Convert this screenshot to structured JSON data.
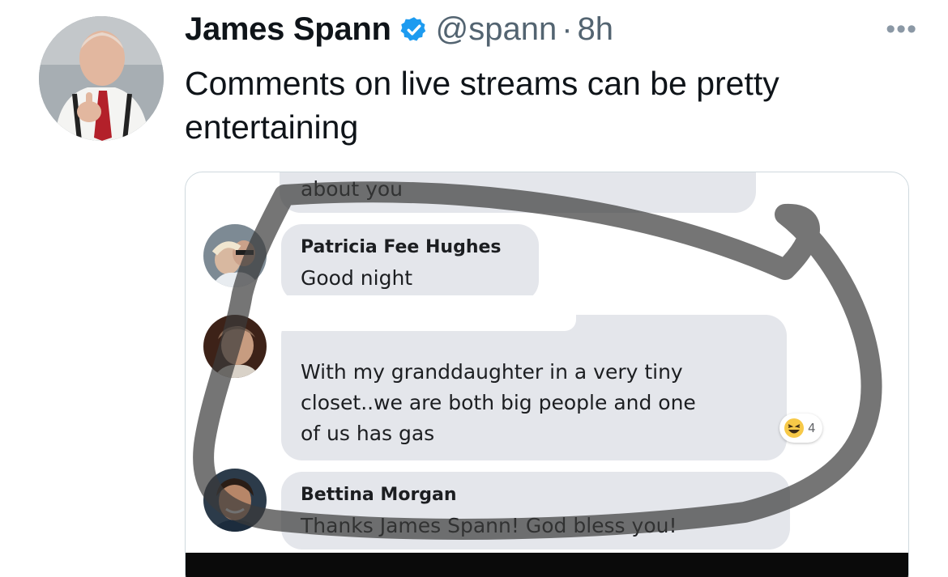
{
  "tweet": {
    "author_name": "James Spann",
    "handle": "@spann",
    "separator": "·",
    "time": "8h",
    "more_label": "•••",
    "text": "Comments on live streams can be pretty entertaining"
  },
  "colors": {
    "verified": "#1d9bf0",
    "handle": "#536471",
    "comment_bubble": "#e4e6eb",
    "marker": "#3a3a3a"
  },
  "icons": {
    "verified": "verified-badge-icon",
    "more": "more-options-icon",
    "reaction": "haha-emoji-icon"
  },
  "screenshot": {
    "partial_comment_text": "about you",
    "comments": [
      {
        "name": "Patricia Fee Hughes",
        "text": "Good night"
      },
      {
        "name": "",
        "lines": [
          "With my granddaughter in a very tiny",
          "closet..we are both big people and one",
          "of us has gas"
        ],
        "reaction_count": "4"
      },
      {
        "name": "Bettina Morgan",
        "text": "Thanks James Spann! God bless you!"
      }
    ]
  }
}
